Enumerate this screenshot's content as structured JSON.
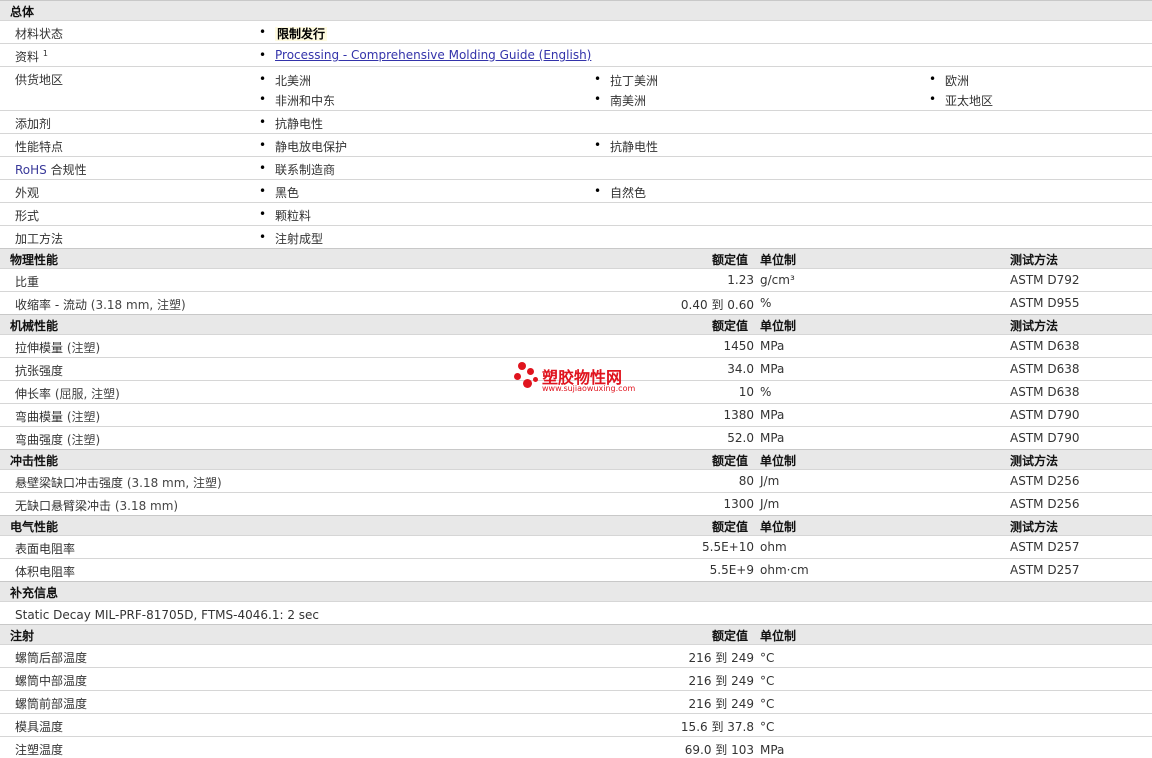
{
  "general": {
    "title": "总体",
    "material_status": {
      "label": "材料状态",
      "value": "限制发行"
    },
    "documents": {
      "label": "资料",
      "sup": "1",
      "link": "Processing - Comprehensive Molding Guide (English)"
    },
    "regions": {
      "label": "供货地区",
      "items": [
        "北美洲",
        "拉丁美洲",
        "欧洲",
        "非洲和中东",
        "南美洲",
        "亚太地区"
      ]
    },
    "additive": {
      "label": "添加剂",
      "value": "抗静电性"
    },
    "features": {
      "label": "性能特点",
      "items": [
        "静电放电保护",
        "抗静电性"
      ]
    },
    "rohs": {
      "label_a": "RoHS",
      "label_b": " 合规性",
      "value": "联系制造商"
    },
    "appearance": {
      "label": "外观",
      "items": [
        "黑色",
        "自然色"
      ]
    },
    "form": {
      "label": "形式",
      "value": "颗粒料"
    },
    "processing": {
      "label": "加工方法",
      "value": "注射成型"
    }
  },
  "headers": {
    "nominal": "额定值",
    "unit": "单位制",
    "method": "测试方法"
  },
  "physical": {
    "title": "物理性能",
    "rows": [
      {
        "label": "比重",
        "cond": "",
        "value": "1.23",
        "unit": "g/cm³",
        "method": "ASTM D792"
      },
      {
        "label": "收缩率 - 流动",
        "cond": " (3.18 mm, 注塑)",
        "value": "0.40 到  0.60",
        "unit": "%",
        "method": "ASTM D955"
      }
    ]
  },
  "mechanical": {
    "title": "机械性能",
    "rows": [
      {
        "label": "拉伸模量",
        "cond": " (注塑)",
        "value": "1450",
        "unit": "MPa",
        "method": "ASTM D638"
      },
      {
        "label": "抗张强度",
        "cond": "",
        "value": "34.0",
        "unit": "MPa",
        "method": "ASTM D638"
      },
      {
        "label": "伸长率",
        "cond": " (屈服, 注塑)",
        "value": "10",
        "unit": "%",
        "method": "ASTM D638"
      },
      {
        "label": "弯曲模量",
        "cond": " (注塑)",
        "value": "1380",
        "unit": "MPa",
        "method": "ASTM D790"
      },
      {
        "label": "弯曲强度",
        "cond": " (注塑)",
        "value": "52.0",
        "unit": "MPa",
        "method": "ASTM D790"
      }
    ]
  },
  "impact": {
    "title": "冲击性能",
    "rows": [
      {
        "label": "悬壁梁缺口冲击强度",
        "cond": " (3.18 mm, 注塑)",
        "value": "80",
        "unit": "J/m",
        "method": "ASTM D256"
      },
      {
        "label": "无缺口悬臂梁冲击",
        "cond": " (3.18 mm)",
        "value": "1300",
        "unit": "J/m",
        "method": "ASTM D256"
      }
    ]
  },
  "electrical": {
    "title": "电气性能",
    "rows": [
      {
        "label": "表面电阻率",
        "cond": "",
        "value": "5.5E+10",
        "unit": "ohm",
        "method": "ASTM D257"
      },
      {
        "label": "体积电阻率",
        "cond": "",
        "value": "5.5E+9",
        "unit": "ohm·cm",
        "method": "ASTM D257"
      }
    ]
  },
  "supplement": {
    "title": "补充信息",
    "note": "Static Decay MIL-PRF-81705D, FTMS-4046.1: 2 sec"
  },
  "injection": {
    "title": "注射",
    "rows": [
      {
        "label": "螺筒后部温度",
        "value": "216 到  249",
        "unit": "°C"
      },
      {
        "label": "螺筒中部温度",
        "value": "216 到  249",
        "unit": "°C"
      },
      {
        "label": "螺筒前部温度",
        "value": "216 到  249",
        "unit": "°C"
      },
      {
        "label": "模具温度",
        "value": "15.6 到  37.8",
        "unit": "°C"
      },
      {
        "label": "注塑温度",
        "value": "69.0 到  103",
        "unit": "MPa"
      }
    ]
  },
  "watermark": {
    "text": "塑胶物性网",
    "url": "www.sujiaowuxing.com",
    "color": "#e0141e"
  }
}
